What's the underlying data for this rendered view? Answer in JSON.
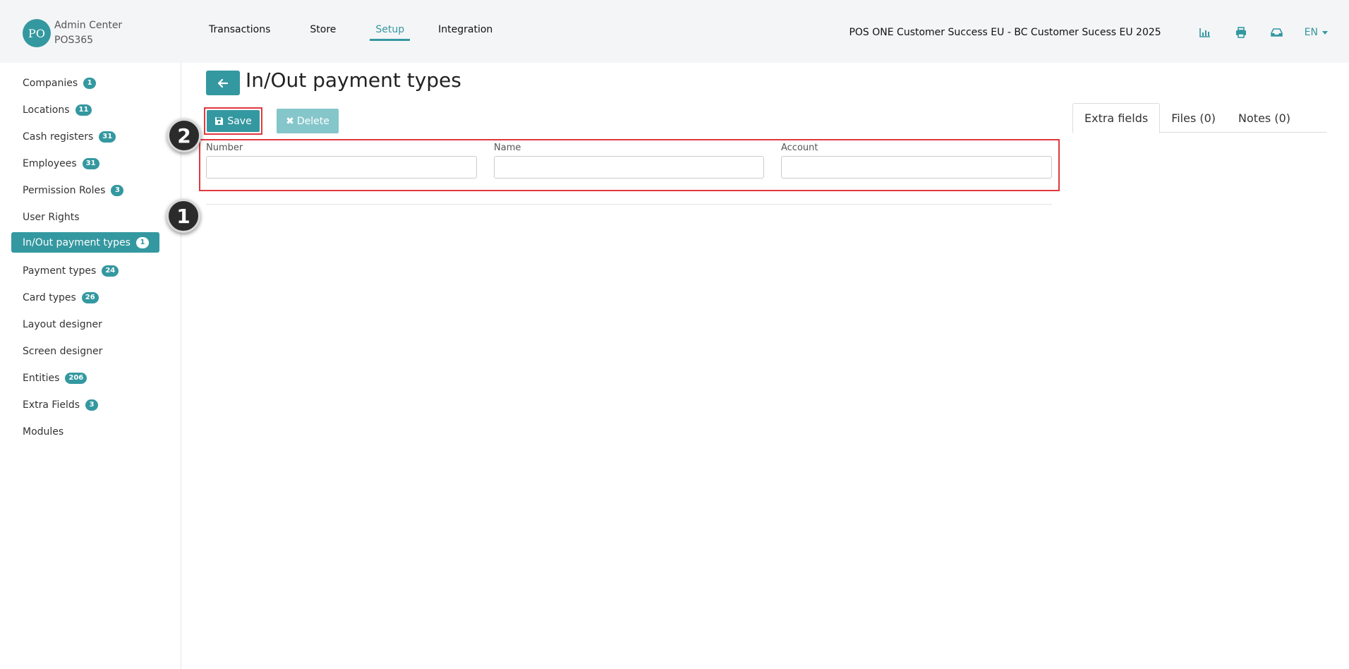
{
  "brand": {
    "initials": "PO",
    "title": "Admin Center",
    "subtitle": "POS365"
  },
  "nav": [
    {
      "label": "Transactions"
    },
    {
      "label": "Store"
    },
    {
      "label": "Setup"
    },
    {
      "label": "Integration"
    }
  ],
  "header": {
    "organization": "POS ONE Customer Success EU - BC Customer Sucess EU 2025",
    "language": "EN"
  },
  "icons": {
    "accent": "#3498a0",
    "highlight": "#e0393e"
  },
  "sidebar": {
    "items": [
      {
        "label": "Companies",
        "badge": "1"
      },
      {
        "label": "Locations",
        "badge": "11"
      },
      {
        "label": "Cash registers",
        "badge": "31"
      },
      {
        "label": "Employees",
        "badge": "31"
      },
      {
        "label": "Permission Roles",
        "badge": "3"
      },
      {
        "label": "User Rights"
      },
      {
        "label": "In/Out payment types",
        "badge": "1"
      },
      {
        "label": "Payment types",
        "badge": "24"
      },
      {
        "label": "Card types",
        "badge": "26"
      },
      {
        "label": "Layout designer"
      },
      {
        "label": "Screen designer"
      },
      {
        "label": "Entities",
        "badge": "206"
      },
      {
        "label": "Extra Fields",
        "badge": "3"
      },
      {
        "label": "Modules"
      }
    ]
  },
  "page": {
    "title": "In/Out payment types"
  },
  "toolbar": {
    "save_label": "Save",
    "delete_label": "Delete"
  },
  "form": {
    "number_label": "Number",
    "number_value": "",
    "name_label": "Name",
    "name_value": "",
    "account_label": "Account",
    "account_value": ""
  },
  "tabs": [
    {
      "label": "Extra fields"
    },
    {
      "label": "Files (0)"
    },
    {
      "label": "Notes (0)"
    }
  ],
  "steps": {
    "one": "1",
    "two": "2"
  }
}
